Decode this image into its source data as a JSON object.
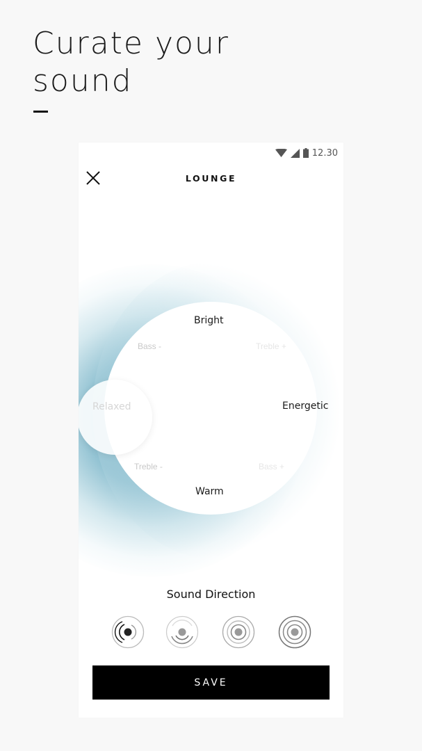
{
  "headline": {
    "line1": "Curate your",
    "line2": "sound"
  },
  "status_bar": {
    "time": "12.30"
  },
  "screen": {
    "title": "LOUNGE"
  },
  "dial": {
    "top": "Bright",
    "right": "Energetic",
    "bottom": "Warm",
    "left": "Relaxed",
    "upper_left": "Bass -",
    "upper_right": "Treble +",
    "lower_left": "Treble -",
    "lower_right": "Bass +"
  },
  "sound_direction": {
    "title": "Sound Direction",
    "options": [
      "narrow",
      "medium",
      "wide",
      "widest"
    ],
    "selected_index": 0
  },
  "actions": {
    "save_label": "SAVE"
  },
  "colors": {
    "accent_glow": "#5fa2b9",
    "button_bg": "#000000",
    "background": "#f8f8f8"
  }
}
